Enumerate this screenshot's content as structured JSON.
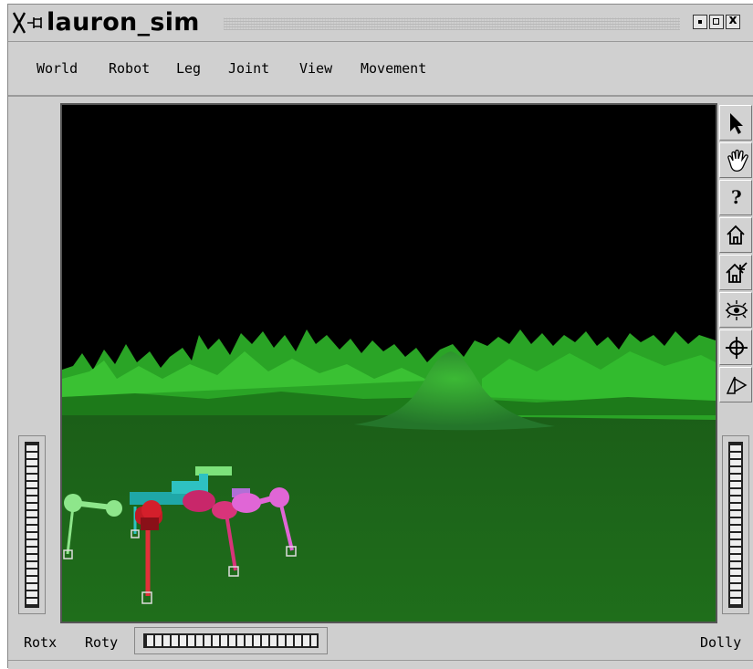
{
  "window": {
    "title": "lauron_sim",
    "buttons": [
      "minimize",
      "maximize",
      "close"
    ],
    "close_glyph": "x"
  },
  "menubar": {
    "items": [
      "World",
      "Robot",
      "Leg",
      "Joint",
      "View",
      "Movement"
    ]
  },
  "toolbar": {
    "tools": [
      "select-arrow-icon",
      "hand-pan-icon",
      "help-question-icon",
      "home-icon",
      "set-home-icon",
      "view-all-eye-icon",
      "seek-crosshair-icon",
      "perspective-icon"
    ],
    "help_glyph": "?"
  },
  "thumbwheels": {
    "left_label": "Rotx",
    "bottom_label": "Roty",
    "right_label": "Dolly"
  },
  "scene": {
    "sky_color": "#000000",
    "ground_color": "#1f6e1b",
    "terrain_color": "#2fb12a",
    "robot_leg_colors": [
      "#7de27b",
      "#2ec1c1",
      "#d41f2b",
      "#c8276a",
      "#e066d6"
    ]
  }
}
